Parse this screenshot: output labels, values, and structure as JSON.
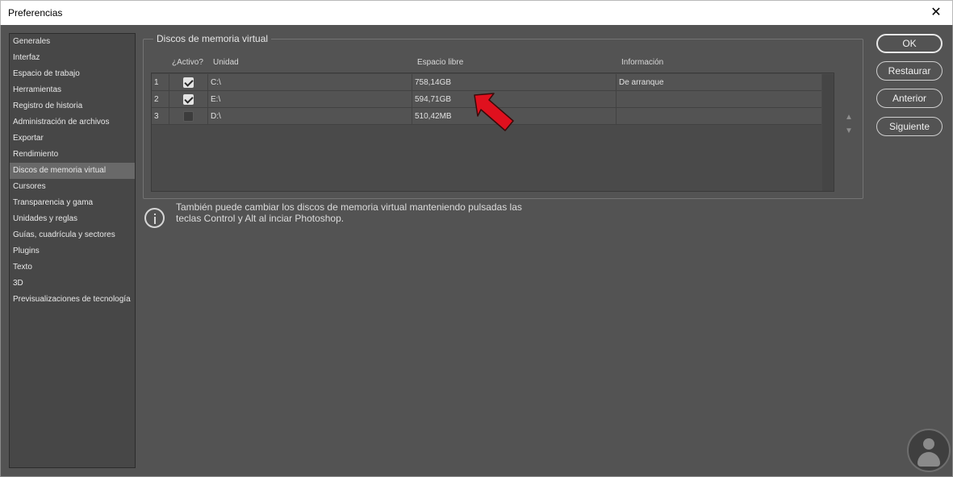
{
  "window": {
    "title": "Preferencias",
    "close_glyph": "✕"
  },
  "sidebar": {
    "items": [
      {
        "label": "Generales",
        "selected": false
      },
      {
        "label": "Interfaz",
        "selected": false
      },
      {
        "label": "Espacio de trabajo",
        "selected": false
      },
      {
        "label": "Herramientas",
        "selected": false
      },
      {
        "label": "Registro de historia",
        "selected": false
      },
      {
        "label": "Administración de archivos",
        "selected": false
      },
      {
        "label": "Exportar",
        "selected": false
      },
      {
        "label": "Rendimiento",
        "selected": false
      },
      {
        "label": "Discos de memoria virtual",
        "selected": true
      },
      {
        "label": "Cursores",
        "selected": false
      },
      {
        "label": "Transparencia y gama",
        "selected": false
      },
      {
        "label": "Unidades y reglas",
        "selected": false
      },
      {
        "label": "Guías, cuadrícula y sectores",
        "selected": false
      },
      {
        "label": "Plugins",
        "selected": false
      },
      {
        "label": "Texto",
        "selected": false
      },
      {
        "label": "3D",
        "selected": false
      },
      {
        "label": "Previsualizaciones de tecnología",
        "selected": false
      }
    ]
  },
  "scratch": {
    "group_title": "Discos de memoria virtual",
    "columns": {
      "active": "¿Activo?",
      "unit": "Unidad",
      "space": "Espacio libre",
      "info": "Información"
    },
    "rows": [
      {
        "num": "1",
        "active": true,
        "unit": "C:\\",
        "space": "758,14GB",
        "info": "De arranque"
      },
      {
        "num": "2",
        "active": true,
        "unit": "E:\\",
        "space": "594,71GB",
        "info": ""
      },
      {
        "num": "3",
        "active": false,
        "unit": "D:\\",
        "space": "510,42MB",
        "info": ""
      }
    ],
    "move_up_glyph": "▲",
    "move_down_glyph": "▼"
  },
  "info": {
    "text_line1": "También puede cambiar los discos de memoria virtual manteniendo pulsadas las",
    "text_line2": "teclas Control y Alt al inciar Photoshop."
  },
  "buttons": {
    "ok": "OK",
    "reset": "Restaurar",
    "prev": "Anterior",
    "next": "Siguiente"
  },
  "colors": {
    "background": "#535353",
    "annotation_arrow": "#e0101e"
  }
}
